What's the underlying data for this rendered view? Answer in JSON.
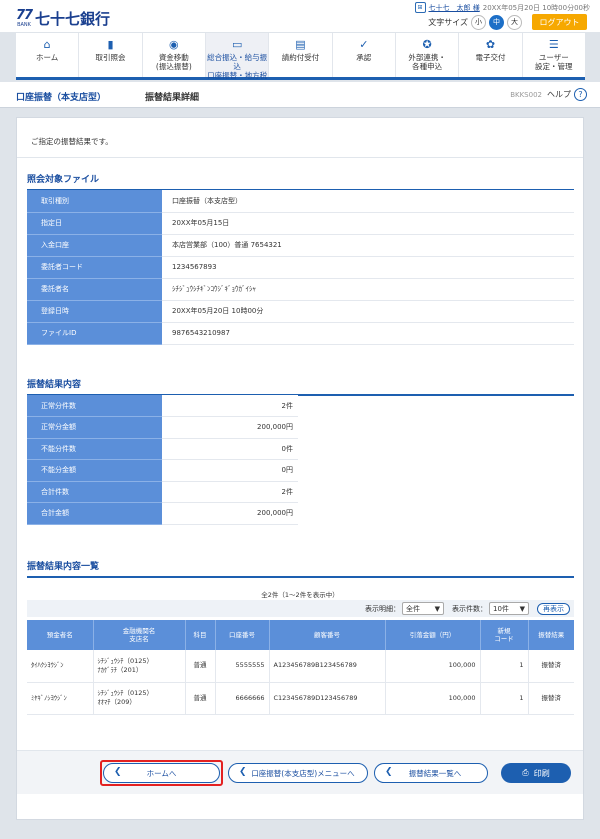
{
  "brand": {
    "mark": "77",
    "mark_sub": "BANK",
    "name": "七十七銀行"
  },
  "user": {
    "icon": "user-badge-icon",
    "name": "七十七　太郎 様",
    "last_login": "20XX年05月20日 10時00分00秒"
  },
  "font_size": {
    "label": "文字サイズ",
    "options": [
      "小",
      "中",
      "大"
    ],
    "selected": "中"
  },
  "logout_label": "ログアウト",
  "nav": [
    {
      "icon": "home-icon",
      "lines": [
        "ホーム"
      ]
    },
    {
      "icon": "inquiry-icon",
      "lines": [
        "取引照会"
      ]
    },
    {
      "icon": "fund-transfer-icon",
      "lines": [
        "資金移動",
        "(振込振替)"
      ]
    },
    {
      "icon": "bulk-transfer-icon",
      "lines": [
        "総合振込・給与振込",
        "口座振替・地方税"
      ],
      "active": true
    },
    {
      "icon": "invoice-icon",
      "lines": [
        "請約付受付"
      ]
    },
    {
      "icon": "approval-icon",
      "lines": [
        "承認"
      ]
    },
    {
      "icon": "external-link-icon",
      "lines": [
        "外部連携・",
        "各種申込"
      ]
    },
    {
      "icon": "e-delivery-icon",
      "lines": [
        "電子交付"
      ]
    },
    {
      "icon": "user-settings-icon",
      "lines": [
        "ユーザー",
        "設定・管理"
      ]
    }
  ],
  "title": {
    "service": "口座振替（本支店型）",
    "screen": "振替結果詳細",
    "screen_id": "BKKS002",
    "help_label": "ヘルプ",
    "help_icon": "?"
  },
  "intro": "ご指定の振替結果です。",
  "file_section": {
    "title": "照会対象ファイル",
    "rows": [
      {
        "label": "取引種別",
        "value": "口座振替（本支店型）"
      },
      {
        "label": "指定日",
        "value": "20XX年05月15日"
      },
      {
        "label": "入金口座",
        "value": "本店営業部（100）普通 7654321"
      },
      {
        "label": "委託者コード",
        "value": "1234567893"
      },
      {
        "label": "委託者名",
        "value": "ｼﾁｼﾞｭｳｼﾁｷﾞﾝｺｳｼﾞｷﾞｮｳｶﾞｲｼｬ"
      },
      {
        "label": "登録日時",
        "value": "20XX年05月20日 10時00分"
      },
      {
        "label": "ファイルID",
        "value": "9876543210987"
      }
    ]
  },
  "result_section": {
    "title": "振替結果内容",
    "rows": [
      {
        "label": "正常分件数",
        "value": "2件"
      },
      {
        "label": "正常分金額",
        "value": "200,000円"
      },
      {
        "label": "不能分件数",
        "value": "0件"
      },
      {
        "label": "不能分金額",
        "value": "0円"
      },
      {
        "label": "合計件数",
        "value": "2件"
      },
      {
        "label": "合計金額",
        "value": "200,000円"
      }
    ]
  },
  "list_section": {
    "title": "振替結果内容一覧",
    "count_text": "全2件（1～2件を表示中）",
    "filter_label": "表示明細：",
    "filter_value": "全件",
    "per_page_label": "表示件数：",
    "per_page_value": "10件",
    "redisplay_label": "再表示",
    "columns": [
      "預金者名",
      "金融機関名\n支店名",
      "科目",
      "口座番号",
      "顧客番号",
      "引落金額（円）",
      "新規\nコード",
      "振替結果"
    ],
    "rows": [
      {
        "name": "ﾀｲﾊｸｼﾖｳｼﾞﾝ",
        "bank": "ｼﾁｼﾞｭｳｼﾁ（0125）",
        "branch": "ﾅｶｹﾞﾗﾁ（201）",
        "type": "普通",
        "account": "5555555",
        "customer": "A123456789B123456789",
        "amount": "100,000",
        "code": "1",
        "result": "振替済"
      },
      {
        "name": "ﾐﾔｷﾞﾉｼﾖｳｼﾞﾝ",
        "bank": "ｼﾁｼﾞｭｳｼﾁ（0125）",
        "branch": "ｵｵﾏﾁ（209）",
        "type": "普通",
        "account": "6666666",
        "customer": "C123456789D123456789",
        "amount": "100,000",
        "code": "1",
        "result": "振替済"
      }
    ]
  },
  "buttons": {
    "home": "ホームへ",
    "service_menu": "口座振替(本支店型)メニューへ",
    "result_list": "振替結果一覧へ",
    "print": "印刷"
  },
  "colors": {
    "primary": "#1d5fb0",
    "header_cell": "#5b8fd9",
    "logout": "#f6a800",
    "highlight": "#e32121"
  }
}
